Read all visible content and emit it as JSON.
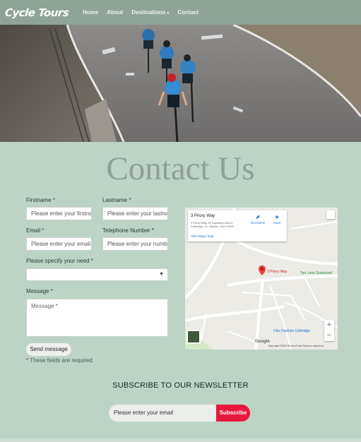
{
  "nav": {
    "brand": "Cycle Tours",
    "links": [
      "Home",
      "About",
      "Destinations",
      "Contact"
    ],
    "caret": "▾"
  },
  "hero": {
    "image": "cyclists-on-mountain-road"
  },
  "page_title": "Contact Us",
  "form": {
    "firstname_label": "Firstname *",
    "firstname_placeholder": "Please enter your firstname",
    "lastname_label": "Lastname *",
    "lastname_placeholder": "Please enter your lastname",
    "email_label": "Email *",
    "email_placeholder": "Please enter your email",
    "phone_label": "Telephone Number *",
    "phone_placeholder": "Please enter your number",
    "need_label": "Please specify your need *",
    "need_value": "",
    "message_label": "Message *",
    "message_placeholder": "Message *",
    "send_label": "Send message",
    "required_note": "* These fields are required."
  },
  "map": {
    "place_name": "3 Priory Way",
    "address": "3 Priory Way, St Raphaels Manor, Celbridge, Co. Kildare, W23 NH22",
    "directions_label": "Directions",
    "save_label": "Save",
    "larger_map_label": "View larger map",
    "pin_label": "3 Priory Way",
    "poi_graveyard": "Tea Lane Graveyard",
    "poi_shop": "Chic Fashion Celbridge",
    "google_label": "Google",
    "attribution": "Map data ©2019   Terms of Use   Report a map error",
    "zoom_in": "+",
    "zoom_out": "−"
  },
  "newsletter": {
    "title": "SUBSCRIBE TO OUR NEWSLETTER",
    "placeholder": "Please enter your email",
    "button_label": "Subscribe"
  },
  "colors": {
    "background": "#bdd3c6",
    "navbar": "#8fa397",
    "accent_red": "#e8173d",
    "title_gray": "#909f97"
  }
}
